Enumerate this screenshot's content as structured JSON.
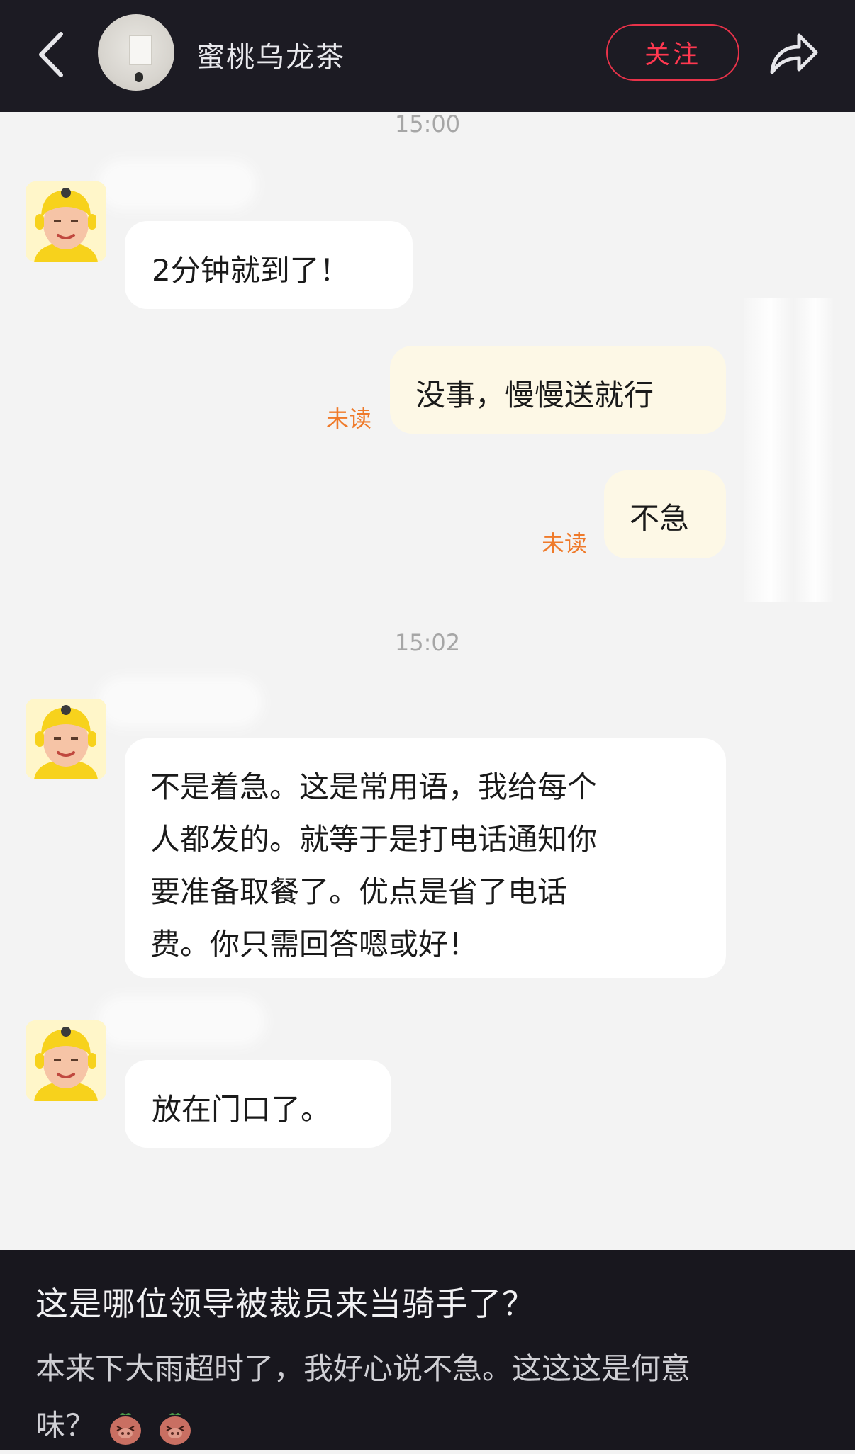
{
  "header": {
    "title": "蜜桃乌龙茶",
    "follow_label": "关注"
  },
  "chat": {
    "timestamp_1": "15:00",
    "timestamp_2": "15:02",
    "messages": {
      "m1": "2分钟就到了！",
      "m2": "没事，慢慢送就行",
      "m3": "不急",
      "m4_lines": [
        "不是着急。这是常用语，我给每个",
        "人都发的。就等于是打电话通知你",
        "要准备取餐了。优点是省了电话",
        "费。你只需回答嗯或好！"
      ],
      "m5": "放在门口了。"
    },
    "unread_label": "未读"
  },
  "post": {
    "title": "这是哪位领导被裁员来当骑手了？",
    "body_line_1": "本来下大雨超时了，我好心说不急。这这这是何意",
    "body_line_2": "味？"
  },
  "colors": {
    "header_bg": "#1c1b23",
    "follow_accent": "#ff3850",
    "unread": "#ef7a2a",
    "chat_bg": "#f3f3f3",
    "my_bubble": "#fdf8e6"
  },
  "icons": {
    "back": "chevron-left-icon",
    "share": "share-arrow-icon",
    "emoji": "pig-face-emoji-icon"
  }
}
